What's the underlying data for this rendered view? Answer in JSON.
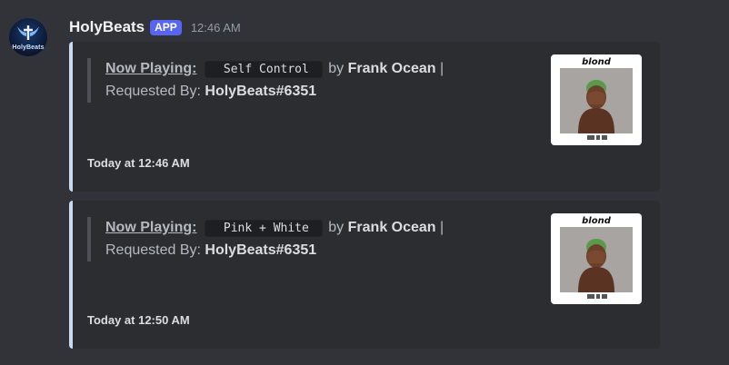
{
  "bot": {
    "name": "HolyBeats",
    "badge": "APP",
    "time": "12:46 AM",
    "avatar_text": "HolyBeats"
  },
  "colors": {
    "background": "#313338",
    "embed_bg": "#2b2d31",
    "embed_accent": "#c5dcf2",
    "badge": "#5865f2"
  },
  "messages": [
    {
      "now_playing_label": "Now Playing:",
      "song": "Self Control",
      "by_text": "by",
      "artist": "Frank Ocean",
      "separator": "|",
      "requested_label": "Requested By:",
      "requester": "HolyBeats#6351",
      "footer": "Today at 12:46 AM",
      "thumbnail_title": "blond",
      "thumbnail_icon": "album-cover"
    },
    {
      "now_playing_label": "Now Playing:",
      "song": "Pink + White",
      "by_text": "by",
      "artist": "Frank Ocean",
      "separator": "|",
      "requested_label": "Requested By:",
      "requester": "HolyBeats#6351",
      "footer": "Today at 12:50 AM",
      "thumbnail_title": "blond",
      "thumbnail_icon": "album-cover"
    }
  ]
}
